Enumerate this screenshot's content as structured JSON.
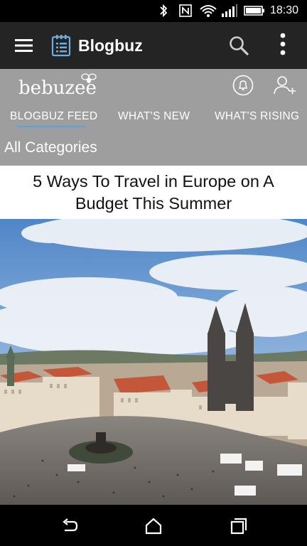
{
  "status_bar": {
    "time": "18:30",
    "icons": [
      "bluetooth-icon",
      "nfc-icon",
      "wifi-icon",
      "signal-icon",
      "battery-icon"
    ]
  },
  "app_bar": {
    "title": "Blogbuz",
    "icons": [
      "menu-icon",
      "app-logo-icon",
      "search-icon",
      "overflow-menu-icon"
    ]
  },
  "brand": {
    "name": "bebuzee"
  },
  "header_actions": [
    "notifications-bell-icon",
    "add-user-icon"
  ],
  "tabs": [
    {
      "label": "BLOGBUZ FEED",
      "active": true
    },
    {
      "label": "WHAT'S NEW",
      "active": false
    },
    {
      "label": "WHAT'S RISING",
      "active": false
    }
  ],
  "category": {
    "label": "All Categories"
  },
  "article": {
    "title": "5 Ways To Travel in Europe on A Budget This Summer",
    "image": "old-town-square-photo"
  },
  "nav_bar": {
    "buttons": [
      "back-icon",
      "home-icon",
      "recents-icon"
    ]
  },
  "colors": {
    "status_bar": "#000000",
    "app_bar": "#242424",
    "subheader": "#9e9e9e",
    "accent": "#5aa0e6"
  }
}
